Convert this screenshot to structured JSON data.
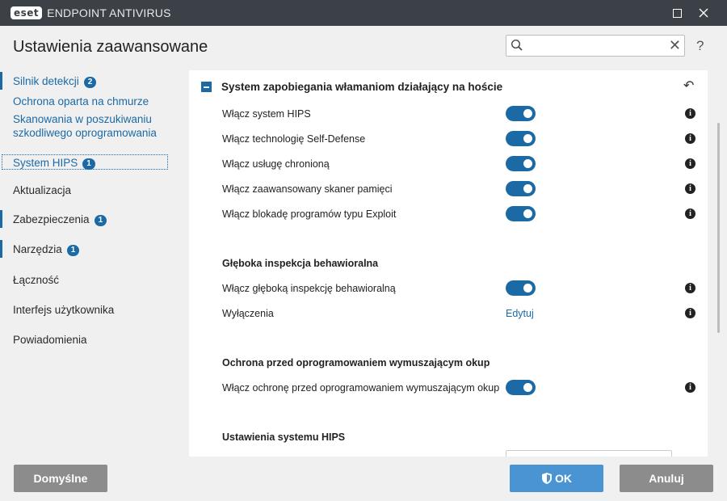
{
  "titlebar": {
    "logo": "eset",
    "product": "ENDPOINT ANTIVIRUS",
    "maximize_icon": "maximize-icon",
    "close_icon": "close-icon"
  },
  "header": {
    "title": "Ustawienia zaawansowane",
    "search_value": "",
    "search_icon": "search-icon",
    "clear_icon": "clear-icon",
    "help_label": "?"
  },
  "sidebar": {
    "items": [
      {
        "label": "Silnik detekcji",
        "badge": "2"
      },
      {
        "label": "Ochrona oparta na chmurze"
      },
      {
        "label": "Skanowania w poszukiwaniu szkodliwego oprogramowania"
      },
      {
        "label": "System HIPS",
        "badge": "1",
        "selected": true
      },
      {
        "label": "Aktualizacja"
      },
      {
        "label": "Zabezpieczenia",
        "badge": "1"
      },
      {
        "label": "Narzędzia",
        "badge": "1"
      },
      {
        "label": "Łączność"
      },
      {
        "label": "Interfejs użytkownika"
      },
      {
        "label": "Powiadomienia"
      }
    ]
  },
  "content": {
    "section_title": "System zapobiegania włamaniom działający na hoście",
    "rows": [
      {
        "label": "Włącz system HIPS",
        "enabled": true
      },
      {
        "label": "Włącz technologię Self-Defense",
        "enabled": true
      },
      {
        "label": "Włącz usługę chronioną",
        "enabled": true
      },
      {
        "label": "Włącz zaawansowany skaner pamięci",
        "enabled": true
      },
      {
        "label": "Włącz blokadę programów typu Exploit",
        "enabled": true
      }
    ],
    "group2": {
      "title": "Głęboka inspekcja behawioralna",
      "rows": [
        {
          "label": "Włącz głęboką inspekcję behawioralną",
          "enabled": true
        },
        {
          "label": "Wyłączenia",
          "link": "Edytuj"
        }
      ]
    },
    "group3": {
      "title": "Ochrona przed oprogramowaniem wymuszającym okup",
      "rows": [
        {
          "label": "Włącz ochronę przed oprogramowaniem wymuszającym okup",
          "enabled": true
        }
      ]
    },
    "group4": {
      "title": "Ustawienia systemu HIPS"
    },
    "info_label": "i"
  },
  "footer": {
    "default_label": "Domyślne",
    "ok_label": "OK",
    "cancel_label": "Anuluj"
  },
  "colors": {
    "accent": "#1b6aa5",
    "titlebar": "#3c4047",
    "ok_button": "#4a94d4",
    "grey_button": "#8c8c8c"
  }
}
